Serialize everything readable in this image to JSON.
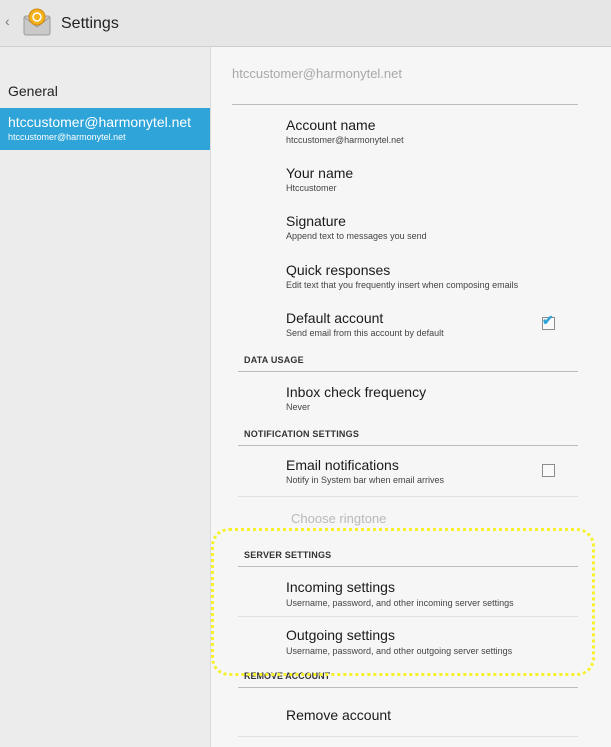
{
  "header": {
    "title": "Settings",
    "back_glyph": "‹",
    "app_icon": "email-app-icon"
  },
  "sidebar": {
    "general_label": "General",
    "selected_account": {
      "label": "htccustomer@harmonytel.net",
      "sublabel": "htccustomer@harmonytel.net"
    }
  },
  "main": {
    "account_header": "htccustomer@harmonytel.net",
    "items": {
      "account_name": {
        "title": "Account name",
        "subtitle": "htccustomer@harmonytel.net"
      },
      "your_name": {
        "title": "Your name",
        "subtitle": "Htccustomer"
      },
      "signature": {
        "title": "Signature",
        "subtitle": "Append text to messages you send"
      },
      "quick_responses": {
        "title": "Quick responses",
        "subtitle": "Edit text that you frequently insert when composing emails"
      },
      "default_account": {
        "title": "Default account",
        "subtitle": "Send email from this account by default",
        "checked": true
      },
      "inbox_check": {
        "title": "Inbox check frequency",
        "subtitle": "Never"
      },
      "email_notifications": {
        "title": "Email notifications",
        "subtitle": "Notify in System bar when email arrives",
        "checked": false
      },
      "choose_ringtone": {
        "title": "Choose ringtone"
      },
      "incoming": {
        "title": "Incoming settings",
        "subtitle": "Username, password, and other incoming server settings"
      },
      "outgoing": {
        "title": "Outgoing settings",
        "subtitle": "Username, password, and other outgoing server settings"
      },
      "remove": {
        "title": "Remove account"
      }
    },
    "sections": {
      "data_usage": "DATA USAGE",
      "notification": "NOTIFICATION SETTINGS",
      "server": "SERVER SETTINGS",
      "remove": "REMOVE ACCOUNT"
    }
  },
  "colors": {
    "accent": "#2ea4d8",
    "highlight": "#f7f12a"
  }
}
